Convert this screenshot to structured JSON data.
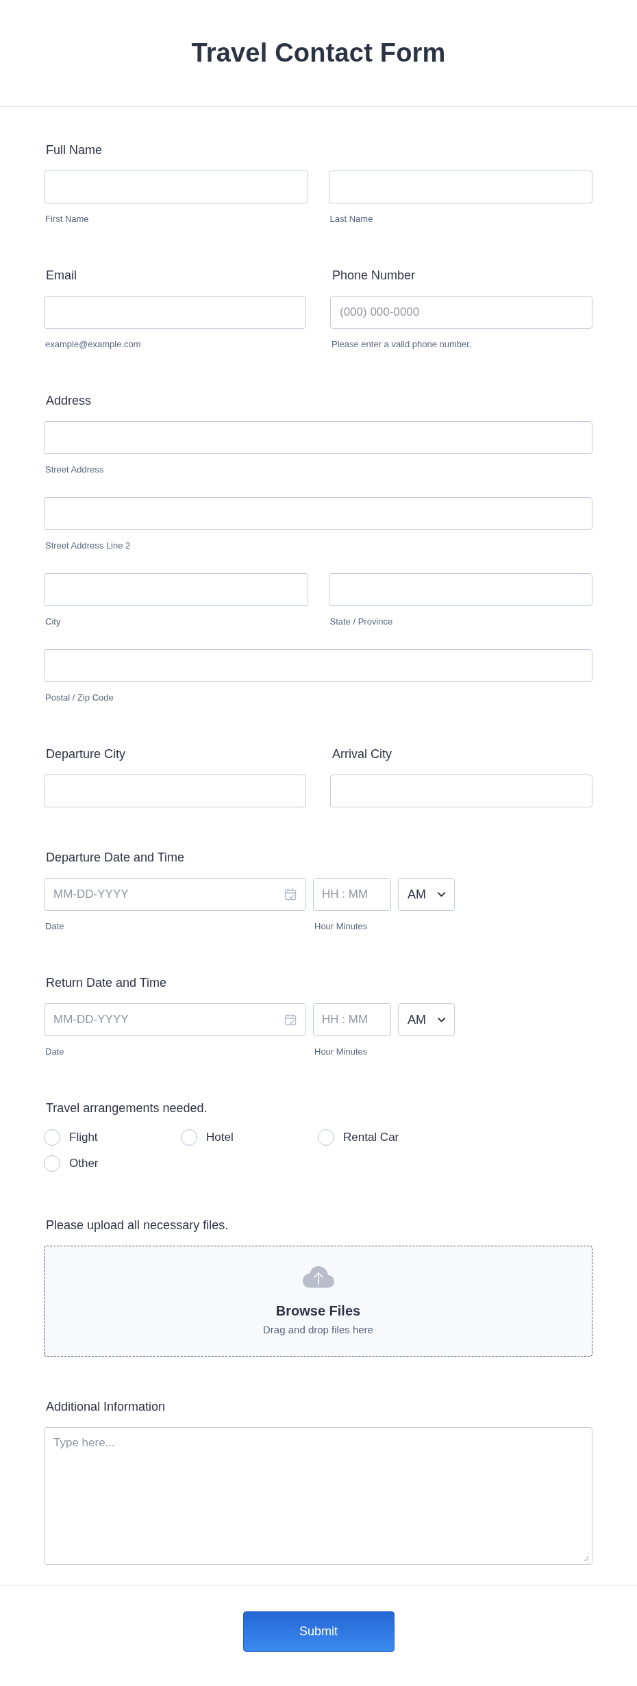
{
  "header": {
    "title": "Travel Contact Form"
  },
  "rows": [
    [
      {
        "kind": "text",
        "label": "Full Name",
        "lines": [
          {
            "fields": [
              {
                "sublabel": "First Name"
              },
              {
                "sublabel": "Last Name"
              }
            ]
          }
        ]
      }
    ],
    [
      {
        "kind": "text",
        "label": "Email",
        "lines": [
          {
            "fields": [
              {
                "sublabel": "example@example.com"
              }
            ]
          }
        ]
      },
      {
        "kind": "text",
        "label": "Phone Number",
        "lines": [
          {
            "fields": [
              {
                "placeholder": "(000) 000-0000",
                "sublabel": "Please enter a valid phone number."
              }
            ]
          }
        ]
      }
    ],
    [
      {
        "kind": "text",
        "label": "Address",
        "lines": [
          {
            "fields": [
              {
                "sublabel": "Street Address"
              }
            ]
          },
          {
            "fields": [
              {
                "sublabel": "Street Address Line 2"
              }
            ]
          },
          {
            "fields": [
              {
                "sublabel": "City"
              },
              {
                "sublabel": "State / Province"
              }
            ]
          },
          {
            "fields": [
              {
                "sublabel": "Postal / Zip Code"
              }
            ]
          }
        ]
      }
    ],
    [
      {
        "kind": "input",
        "label": "Departure City"
      },
      {
        "kind": "input",
        "label": "Arrival City"
      }
    ],
    [
      {
        "kind": "datetime",
        "label": "Departure Date and Time",
        "date": {
          "placeholder": "MM-DD-YYYY",
          "sublabel": "Date"
        },
        "time": {
          "placeholder": "HH : MM",
          "sublabel": "Hour Minutes"
        },
        "period": "AM"
      }
    ],
    [
      {
        "kind": "datetime",
        "label": "Return Date and Time",
        "date": {
          "placeholder": "MM-DD-YYYY",
          "sublabel": "Date"
        },
        "time": {
          "placeholder": "HH : MM",
          "sublabel": "Hour Minutes"
        },
        "period": "AM"
      }
    ],
    [
      {
        "kind": "choices",
        "label": "Travel arrangements needed.",
        "options": [
          {
            "label": "Flight",
            "selected": false
          },
          {
            "label": "Hotel",
            "selected": false
          },
          {
            "label": "Rental Car",
            "selected": false
          },
          {
            "label": "Other",
            "selected": false
          }
        ]
      }
    ],
    [
      {
        "kind": "upload",
        "label": "Please upload all necessary files.",
        "button": "Browse Files",
        "hint": "Drag and drop files here"
      }
    ],
    [
      {
        "kind": "textarea",
        "label": "Additional Information",
        "placeholder": "Type here..."
      }
    ]
  ],
  "submit": {
    "label": "Submit"
  }
}
